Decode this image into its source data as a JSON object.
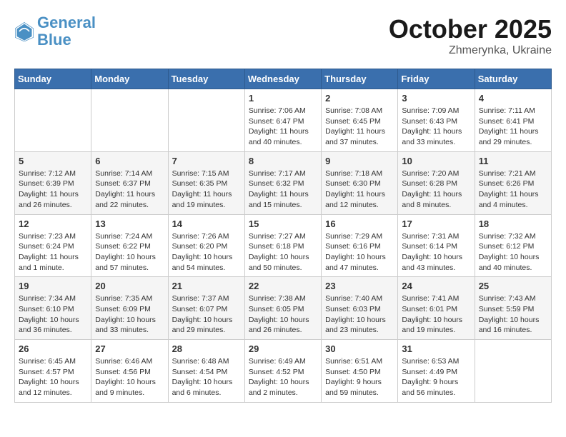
{
  "logo": {
    "line1": "General",
    "line2": "Blue"
  },
  "title": "October 2025",
  "subtitle": "Zhmerynka, Ukraine",
  "weekdays": [
    "Sunday",
    "Monday",
    "Tuesday",
    "Wednesday",
    "Thursday",
    "Friday",
    "Saturday"
  ],
  "weeks": [
    [
      {
        "day": "",
        "info": ""
      },
      {
        "day": "",
        "info": ""
      },
      {
        "day": "",
        "info": ""
      },
      {
        "day": "1",
        "info": "Sunrise: 7:06 AM\nSunset: 6:47 PM\nDaylight: 11 hours and 40 minutes."
      },
      {
        "day": "2",
        "info": "Sunrise: 7:08 AM\nSunset: 6:45 PM\nDaylight: 11 hours and 37 minutes."
      },
      {
        "day": "3",
        "info": "Sunrise: 7:09 AM\nSunset: 6:43 PM\nDaylight: 11 hours and 33 minutes."
      },
      {
        "day": "4",
        "info": "Sunrise: 7:11 AM\nSunset: 6:41 PM\nDaylight: 11 hours and 29 minutes."
      }
    ],
    [
      {
        "day": "5",
        "info": "Sunrise: 7:12 AM\nSunset: 6:39 PM\nDaylight: 11 hours and 26 minutes."
      },
      {
        "day": "6",
        "info": "Sunrise: 7:14 AM\nSunset: 6:37 PM\nDaylight: 11 hours and 22 minutes."
      },
      {
        "day": "7",
        "info": "Sunrise: 7:15 AM\nSunset: 6:35 PM\nDaylight: 11 hours and 19 minutes."
      },
      {
        "day": "8",
        "info": "Sunrise: 7:17 AM\nSunset: 6:32 PM\nDaylight: 11 hours and 15 minutes."
      },
      {
        "day": "9",
        "info": "Sunrise: 7:18 AM\nSunset: 6:30 PM\nDaylight: 11 hours and 12 minutes."
      },
      {
        "day": "10",
        "info": "Sunrise: 7:20 AM\nSunset: 6:28 PM\nDaylight: 11 hours and 8 minutes."
      },
      {
        "day": "11",
        "info": "Sunrise: 7:21 AM\nSunset: 6:26 PM\nDaylight: 11 hours and 4 minutes."
      }
    ],
    [
      {
        "day": "12",
        "info": "Sunrise: 7:23 AM\nSunset: 6:24 PM\nDaylight: 11 hours and 1 minute."
      },
      {
        "day": "13",
        "info": "Sunrise: 7:24 AM\nSunset: 6:22 PM\nDaylight: 10 hours and 57 minutes."
      },
      {
        "day": "14",
        "info": "Sunrise: 7:26 AM\nSunset: 6:20 PM\nDaylight: 10 hours and 54 minutes."
      },
      {
        "day": "15",
        "info": "Sunrise: 7:27 AM\nSunset: 6:18 PM\nDaylight: 10 hours and 50 minutes."
      },
      {
        "day": "16",
        "info": "Sunrise: 7:29 AM\nSunset: 6:16 PM\nDaylight: 10 hours and 47 minutes."
      },
      {
        "day": "17",
        "info": "Sunrise: 7:31 AM\nSunset: 6:14 PM\nDaylight: 10 hours and 43 minutes."
      },
      {
        "day": "18",
        "info": "Sunrise: 7:32 AM\nSunset: 6:12 PM\nDaylight: 10 hours and 40 minutes."
      }
    ],
    [
      {
        "day": "19",
        "info": "Sunrise: 7:34 AM\nSunset: 6:10 PM\nDaylight: 10 hours and 36 minutes."
      },
      {
        "day": "20",
        "info": "Sunrise: 7:35 AM\nSunset: 6:09 PM\nDaylight: 10 hours and 33 minutes."
      },
      {
        "day": "21",
        "info": "Sunrise: 7:37 AM\nSunset: 6:07 PM\nDaylight: 10 hours and 29 minutes."
      },
      {
        "day": "22",
        "info": "Sunrise: 7:38 AM\nSunset: 6:05 PM\nDaylight: 10 hours and 26 minutes."
      },
      {
        "day": "23",
        "info": "Sunrise: 7:40 AM\nSunset: 6:03 PM\nDaylight: 10 hours and 23 minutes."
      },
      {
        "day": "24",
        "info": "Sunrise: 7:41 AM\nSunset: 6:01 PM\nDaylight: 10 hours and 19 minutes."
      },
      {
        "day": "25",
        "info": "Sunrise: 7:43 AM\nSunset: 5:59 PM\nDaylight: 10 hours and 16 minutes."
      }
    ],
    [
      {
        "day": "26",
        "info": "Sunrise: 6:45 AM\nSunset: 4:57 PM\nDaylight: 10 hours and 12 minutes."
      },
      {
        "day": "27",
        "info": "Sunrise: 6:46 AM\nSunset: 4:56 PM\nDaylight: 10 hours and 9 minutes."
      },
      {
        "day": "28",
        "info": "Sunrise: 6:48 AM\nSunset: 4:54 PM\nDaylight: 10 hours and 6 minutes."
      },
      {
        "day": "29",
        "info": "Sunrise: 6:49 AM\nSunset: 4:52 PM\nDaylight: 10 hours and 2 minutes."
      },
      {
        "day": "30",
        "info": "Sunrise: 6:51 AM\nSunset: 4:50 PM\nDaylight: 9 hours and 59 minutes."
      },
      {
        "day": "31",
        "info": "Sunrise: 6:53 AM\nSunset: 4:49 PM\nDaylight: 9 hours and 56 minutes."
      },
      {
        "day": "",
        "info": ""
      }
    ]
  ]
}
